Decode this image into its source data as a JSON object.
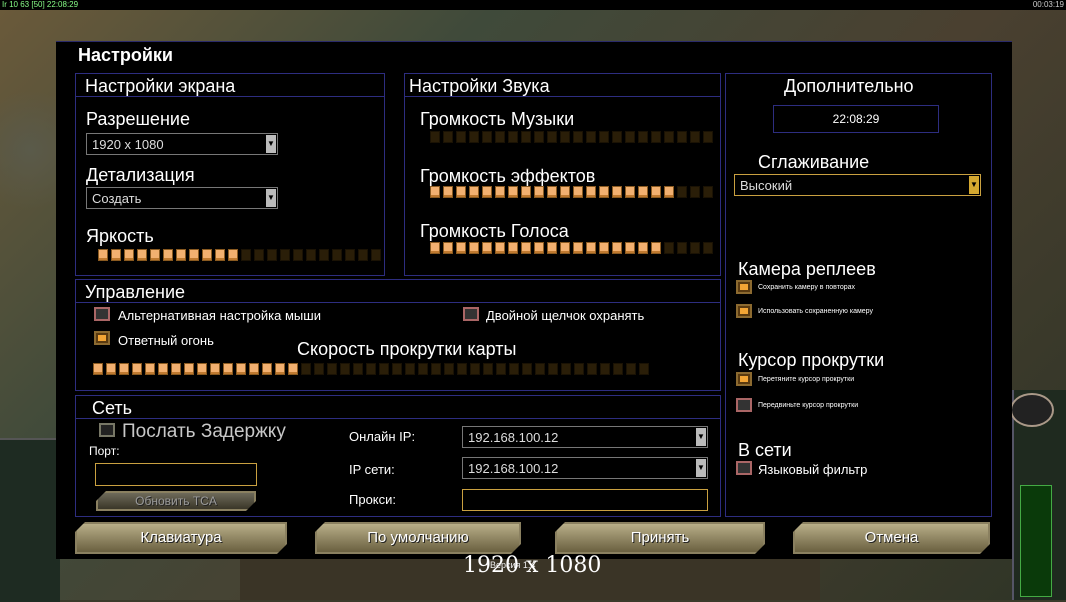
{
  "hud": {
    "top_left": "Ir 10 63 [50] 22:08:29",
    "top_right": "00:03:19"
  },
  "dialog": {
    "title": "Настройки"
  },
  "screen": {
    "title": "Настройки экрана",
    "resolution_label": "Разрешение",
    "resolution_value": "1920 x 1080",
    "detail_label": "Детализация",
    "detail_value": "Создать",
    "brightness_label": "Яркость",
    "brightness_level": 0.5
  },
  "sound": {
    "title": "Настройки Звука",
    "music_label": "Громкость Музыки",
    "music_level": 0,
    "effects_label": "Громкость эффектов",
    "effects_level": 0.87,
    "voice_label": "Громкость Голоса",
    "voice_level": 0.8
  },
  "extra": {
    "title": "Дополнительно",
    "clock": "22:08:29",
    "aa_label": "Сглаживание",
    "aa_value": "Высокий",
    "replay_cam_label": "Камера реплеев",
    "replay_cam_opt1": "Сохранить камеру в повторах",
    "replay_cam_opt2": "Использовать сохраненную камеру",
    "scroll_cursor_label": "Курсор прокрутки",
    "scroll_cursor_opt1": "Перетяните курсор прокрутки",
    "scroll_cursor_opt2": "Передвиньте курсор прокрутки",
    "online_label": "В сети",
    "lang_filter": "Языковый фильтр"
  },
  "controls": {
    "title": "Управление",
    "alt_mouse": "Альтернативная настройка мыши",
    "double_click": "Двойной щелчок охранять",
    "return_fire": "Ответный огонь",
    "scroll_speed_label": "Скорость прокрутки карты",
    "scroll_speed_level": 0.37
  },
  "network": {
    "title": "Сеть",
    "send_delay": "Послать Задержку",
    "port_label": "Порт:",
    "update_tca": "Обновить TCA",
    "online_ip_label": "Онлайн IP:",
    "online_ip_value": "192.168.100.12",
    "lan_ip_label": "IP сети:",
    "lan_ip_value": "192.168.100.12",
    "proxy_label": "Прокси:"
  },
  "buttons": {
    "keyboard": "Клавиатура",
    "defaults": "По умолчанию",
    "accept": "Принять",
    "cancel": "Отмена"
  },
  "version": "Версия 1.4",
  "overlay_text": "1920 x 1080"
}
